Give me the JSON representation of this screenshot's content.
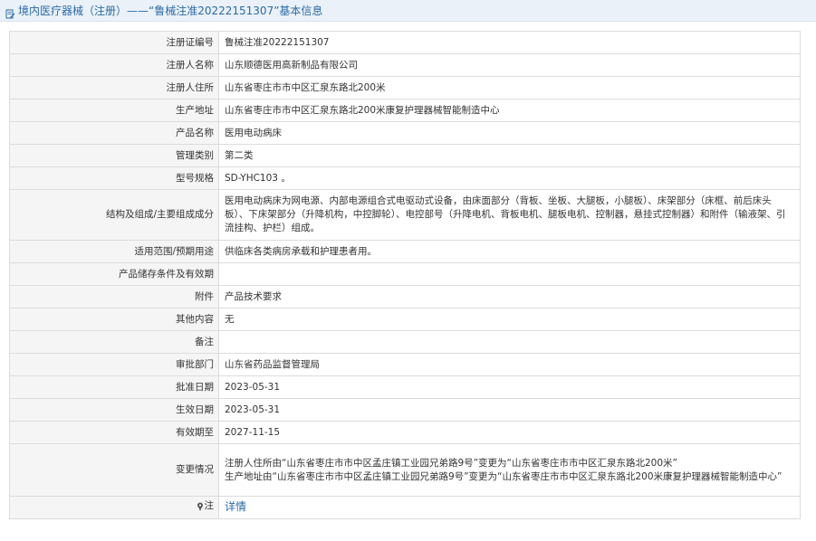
{
  "header": {
    "title": "境内医疗器械（注册）——“鲁械注准20222151307”基本信息",
    "icon": "document-edit-icon"
  },
  "colors": {
    "title_text": "#2b6aa6",
    "title_bar_bg": "#eaf1f8",
    "label_bg": "#f5f5f5",
    "border": "#dcdcdc",
    "link": "#2b6aa6"
  },
  "rows": [
    {
      "label": "注册证编号",
      "value": "鲁械注准20222151307"
    },
    {
      "label": "注册人名称",
      "value": "山东顺德医用高新制品有限公司"
    },
    {
      "label": "注册人住所",
      "value": "山东省枣庄市市中区汇泉东路北200米"
    },
    {
      "label": "生产地址",
      "value": "山东省枣庄市市中区汇泉东路北200米康复护理器械智能制造中心"
    },
    {
      "label": "产品名称",
      "value": "医用电动病床"
    },
    {
      "label": "管理类别",
      "value": "第二类"
    },
    {
      "label": "型号规格",
      "value": "SD-YHC103 。"
    },
    {
      "label": "结构及组成/主要组成成分",
      "value": "医用电动病床为网电源、内部电源组合式电驱动式设备，由床面部分（背板、坐板、大腿板，小腿板）、床架部分（床框、前后床头板）、下床架部分（升降机构，中控脚轮）、电控部号（升降电机、背板电机、腿板电机、控制器，悬挂式控制器）和附件（输液架、引流挂构、护栏）组成。"
    },
    {
      "label": "适用范围/预期用途",
      "value": "供临床各类病房承载和护理患者用。"
    },
    {
      "label": "产品储存条件及有效期",
      "value": ""
    },
    {
      "label": "附件",
      "value": "产品技术要求"
    },
    {
      "label": "其他内容",
      "value": "无"
    },
    {
      "label": "备注",
      "value": ""
    },
    {
      "label": "审批部门",
      "value": "山东省药品监督管理局"
    },
    {
      "label": "批准日期",
      "value": "2023-05-31"
    },
    {
      "label": "生效日期",
      "value": "2023-05-31"
    },
    {
      "label": "有效期至",
      "value": "2027-11-15"
    }
  ],
  "change": {
    "label": "变更情况",
    "line1": "注册人住所由“山东省枣庄市市中区孟庄镇工业园兄弟路9号”变更为“山东省枣庄市市中区汇泉东路北200米”",
    "line2": "生产地址由“山东省枣庄市市中区孟庄镇工业园兄弟路9号”变更为“山东省枣庄市市中区汇泉东路北200米康复护理器械智能制造中心”"
  },
  "note": {
    "label": "注",
    "icon": "pin-icon",
    "link_text": "详情"
  }
}
